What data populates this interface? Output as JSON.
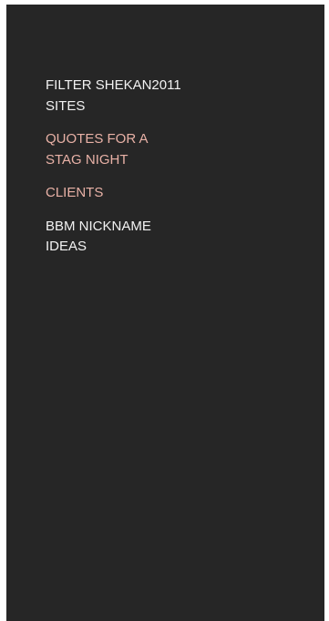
{
  "colors": {
    "background": "#262626",
    "text": "#f2f2f2",
    "highlight": "#e8b1a6"
  },
  "menu": {
    "items": [
      {
        "label": "FILTER SHEKAN2011 SITES",
        "style": "normal"
      },
      {
        "label": "QUOTES FOR A STAG NIGHT",
        "style": "highlight"
      },
      {
        "label": "CLIENTS",
        "style": "highlight"
      },
      {
        "label": "BBM NICKNAME IDEAS",
        "style": "normal"
      }
    ]
  }
}
